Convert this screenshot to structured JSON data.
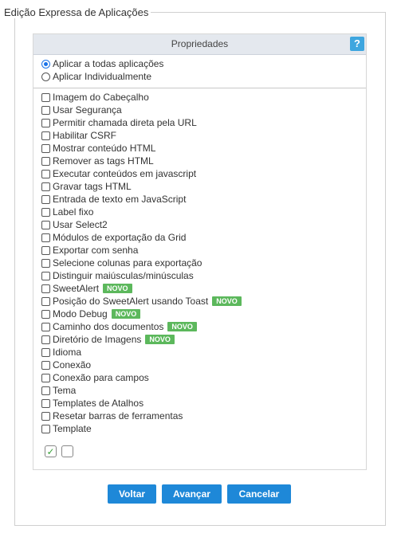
{
  "fieldset": {
    "legend": "Edição Expressa de Aplicações"
  },
  "panel": {
    "title": "Propriedades",
    "help_icon": "?",
    "radios": [
      {
        "label": "Aplicar a todas aplicações",
        "checked": true
      },
      {
        "label": "Aplicar Individualmente",
        "checked": false
      }
    ],
    "options": [
      {
        "label": "Imagem do Cabeçalho"
      },
      {
        "label": "Usar Segurança"
      },
      {
        "label": "Permitir chamada direta pela URL"
      },
      {
        "label": "Habilitar CSRF"
      },
      {
        "label": "Mostrar conteúdo HTML"
      },
      {
        "label": "Remover as tags HTML"
      },
      {
        "label": "Executar conteúdos em javascript"
      },
      {
        "label": "Gravar tags HTML"
      },
      {
        "label": "Entrada de texto em JavaScript"
      },
      {
        "label": "Label fixo"
      },
      {
        "label": "Usar Select2"
      },
      {
        "label": "Módulos de exportação da Grid"
      },
      {
        "label": "Exportar com senha"
      },
      {
        "label": "Selecione colunas para exportação"
      },
      {
        "label": "Distinguir maiúsculas/minúsculas"
      },
      {
        "label": "SweetAlert",
        "badge": "NOVO"
      },
      {
        "label": "Posição do SweetAlert usando Toast",
        "badge": "NOVO"
      },
      {
        "label": "Modo Debug",
        "badge": "NOVO"
      },
      {
        "label": "Caminho dos documentos",
        "badge": "NOVO"
      },
      {
        "label": "Diretório de Imagens",
        "badge": "NOVO"
      },
      {
        "label": "Idioma"
      },
      {
        "label": "Conexão"
      },
      {
        "label": "Conexão para campos"
      },
      {
        "label": "Tema"
      },
      {
        "label": "Templates de Atalhos"
      },
      {
        "label": "Resetar barras de ferramentas"
      },
      {
        "label": "Template"
      }
    ],
    "select_all_glyph": "✓"
  },
  "buttons": {
    "back": "Voltar",
    "next": "Avançar",
    "cancel": "Cancelar"
  },
  "colors": {
    "accent": "#1e88d8",
    "badge": "#5cb85c",
    "help": "#3ea6df"
  }
}
